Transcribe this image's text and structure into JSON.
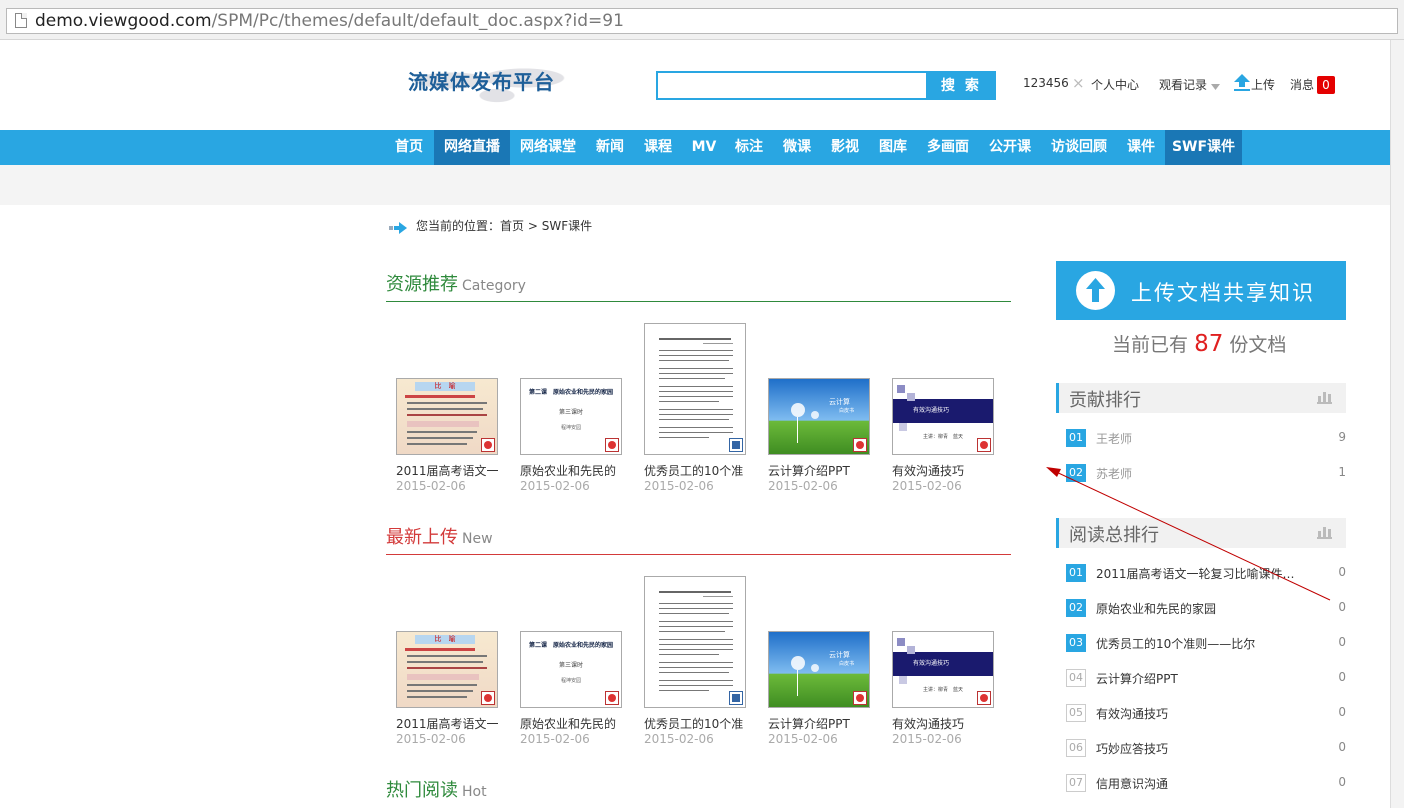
{
  "browser": {
    "url_host": "demo.viewgood.com",
    "url_path": "/SPM/Pc/themes/default/default_doc.aspx?id=91"
  },
  "header": {
    "logo_text": "流媒体发布平台",
    "search_button": "搜 索",
    "user_id": "123456",
    "close_x": "×",
    "personal_center": "个人中心",
    "watch_history": "观看记录",
    "upload": "上传",
    "messages": "消息",
    "message_count": "0"
  },
  "nav": {
    "items": [
      "首页",
      "网络直播",
      "网络课堂",
      "新闻",
      "课程",
      "MV",
      "标注",
      "微课",
      "影视",
      "图库",
      "多画面",
      "公开课",
      "访谈回顾",
      "课件",
      "SWF课件"
    ],
    "active": [
      "网络直播",
      "SWF课件"
    ]
  },
  "breadcrumb": {
    "prefix": "您当前的位置：",
    "home": "首页",
    "sep": ">",
    "current": "SWF课件"
  },
  "sections": [
    {
      "title": "资源推荐",
      "subtitle": "Category",
      "color": "#2f8a3c",
      "items": [
        {
          "caption": "2011届高考语文一",
          "date": "2015-02-06"
        },
        {
          "caption": "原始农业和先民的",
          "date": "2015-02-06"
        },
        {
          "caption": "优秀员工的10个准",
          "date": "2015-02-06"
        },
        {
          "caption": "云计算介绍PPT",
          "date": "2015-02-06"
        },
        {
          "caption": "有效沟通技巧",
          "date": "2015-02-06"
        }
      ]
    },
    {
      "title": "最新上传",
      "subtitle": "New",
      "color": "#d33a3a",
      "items": [
        {
          "caption": "2011届高考语文一",
          "date": "2015-02-06"
        },
        {
          "caption": "原始农业和先民的",
          "date": "2015-02-06"
        },
        {
          "caption": "优秀员工的10个准",
          "date": "2015-02-06"
        },
        {
          "caption": "云计算介绍PPT",
          "date": "2015-02-06"
        },
        {
          "caption": "有效沟通技巧",
          "date": "2015-02-06"
        }
      ]
    },
    {
      "title": "热门阅读",
      "subtitle": "Hot",
      "color": "#2f8a3c"
    }
  ],
  "thumbs": {
    "t1_title": "比　喻",
    "t2_title": "第二课　原始农业和先民的家园",
    "t2_sub": "第三课时",
    "t2_author": "程坤安园",
    "t4_title": "云计算",
    "t4_sub": "白皮书",
    "t5_title": "有效沟通技巧",
    "t5_sub": "主讲：柳青　蓝天"
  },
  "sidebar": {
    "upload_label": "上传文档共享知识",
    "count_prefix": "当前已有",
    "count": "87",
    "count_suffix": "份文档",
    "contrib_title": "贡献排行",
    "contrib": [
      {
        "no": "01",
        "name": "王老师",
        "value": "9"
      },
      {
        "no": "02",
        "name": "苏老师",
        "value": "1"
      }
    ],
    "read_title": "阅读总排行",
    "read": [
      {
        "no": "01",
        "name": "2011届高考语文一轮复习比喻课件…",
        "value": "0"
      },
      {
        "no": "02",
        "name": "原始农业和先民的家园",
        "value": "0"
      },
      {
        "no": "03",
        "name": "优秀员工的10个准则——比尔",
        "value": "0"
      },
      {
        "no": "04",
        "name": "云计算介绍PPT",
        "value": "0"
      },
      {
        "no": "05",
        "name": "有效沟通技巧",
        "value": "0"
      },
      {
        "no": "06",
        "name": "巧妙应答技巧",
        "value": "0"
      },
      {
        "no": "07",
        "name": "信用意识沟通",
        "value": "0"
      }
    ]
  },
  "colors": {
    "brand": "#29a6e2",
    "nav_active": "#1a77b5",
    "accent_red": "#e02020"
  }
}
